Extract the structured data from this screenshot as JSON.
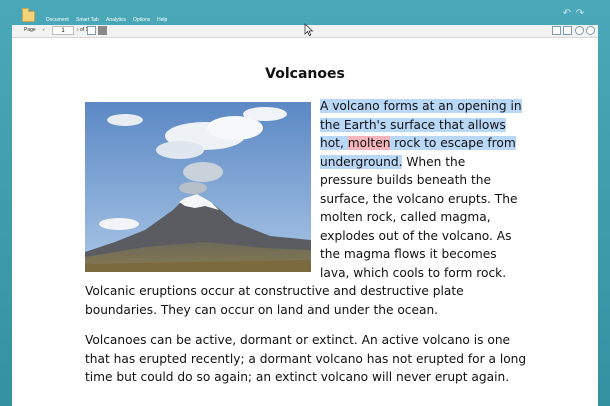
{
  "menu": {
    "items": [
      "Document",
      "Smart Tab",
      "Analytics",
      "Options",
      "Help"
    ]
  },
  "toolbar": {
    "page_label": "Page",
    "page_value": "1",
    "of_label": "of 1"
  },
  "document": {
    "title": "Volcanoes",
    "right_column": {
      "highlighted_lines": [
        "A volcano forms at an opening in",
        "the Earth's surface that allows"
      ],
      "line3_pre": "hot, ",
      "line3_red": "molten",
      "line3_post": " rock to escape from",
      "line4_highlight": "underground.",
      "line4_rest": " When the",
      "plain_lines": [
        "pressure builds beneath the",
        "surface, the volcano erupts. The",
        "molten rock, called magma,",
        "explodes out of the volcano. As",
        "the magma flows it becomes",
        "lava, which cools to form rock."
      ]
    },
    "para1_full_lines": [
      "Volcanic eruptions occur at constructive and destructive plate",
      "boundaries. They can occur on land and under the ocean."
    ],
    "para2_lines": [
      "Volcanoes can be active, dormant or extinct. An active volcano is one",
      "that has erupted recently; a dormant volcano has not erupted for a long",
      "time but could do so again; an extinct volcano will never erupt again."
    ]
  },
  "colors": {
    "frame": "#3a9aaa",
    "highlight_blue": "#b9d7f7",
    "highlight_red": "#f6b5bd"
  }
}
